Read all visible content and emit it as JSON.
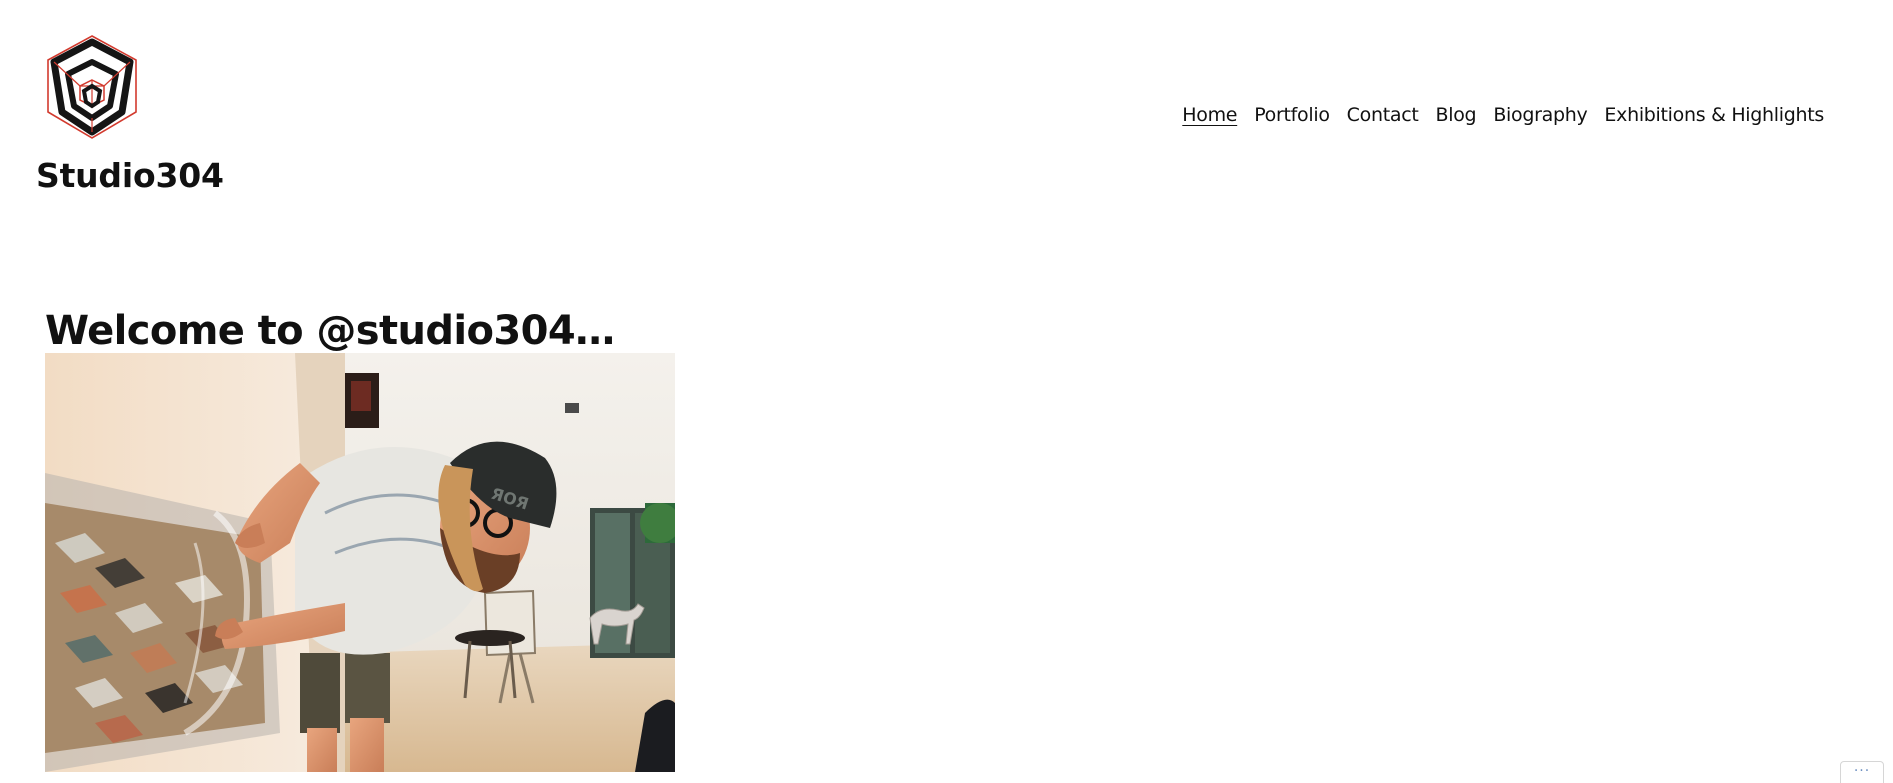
{
  "site": {
    "title": "Studio304",
    "logo_icon": "geometric-hexagon-logo",
    "accent_color": "#d23a2e"
  },
  "nav": {
    "items": [
      {
        "label": "Home",
        "current": true
      },
      {
        "label": "Portfolio"
      },
      {
        "label": "Contact"
      },
      {
        "label": "Blog"
      },
      {
        "label": "Biography"
      },
      {
        "label": "Exhibitions & Highlights"
      }
    ]
  },
  "post": {
    "title": "Welcome to @studio304…"
  },
  "widget": {
    "more_label": "···"
  }
}
